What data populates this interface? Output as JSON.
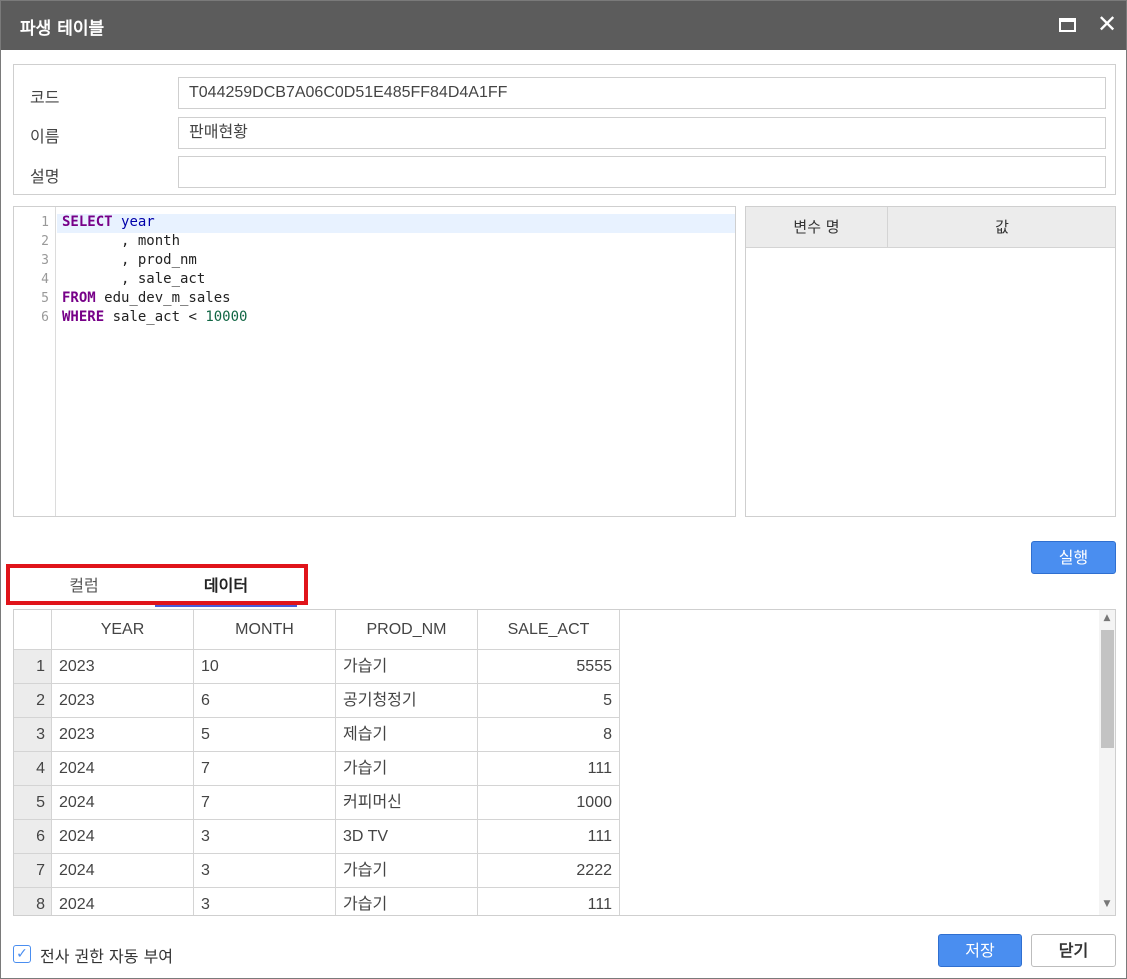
{
  "window": {
    "title": "파생 테이블",
    "maximize_icon": "maximize-icon",
    "close_icon": "close-icon",
    "close_glyph": "✕"
  },
  "form": {
    "code_label": "코드",
    "code_value": "T044259DCB7A06C0D51E485FF84D4A1FF",
    "name_label": "이름",
    "name_value": "판매현황",
    "desc_label": "설명",
    "desc_value": ""
  },
  "editor": {
    "line_numbers": [
      "1",
      "2",
      "3",
      "4",
      "5",
      "6"
    ],
    "lines": [
      {
        "kw": "SELECT",
        "rest": " ",
        "var": "year",
        "num": ""
      },
      {
        "kw": "",
        "rest": "       , month",
        "var": "",
        "num": ""
      },
      {
        "kw": "",
        "rest": "       , prod_nm",
        "var": "",
        "num": ""
      },
      {
        "kw": "",
        "rest": "       , sale_act",
        "var": "",
        "num": ""
      },
      {
        "kw": "FROM",
        "rest": " edu_dev_m_sales",
        "var": "",
        "num": ""
      },
      {
        "kw": "WHERE",
        "rest": " sale_act < ",
        "var": "",
        "num": "10000"
      }
    ]
  },
  "variables": {
    "col_name": "변수 명",
    "col_value": "값"
  },
  "run_button": "실행",
  "tabs": {
    "columns": "컬럼",
    "data": "데이터",
    "active": "data"
  },
  "grid": {
    "headers": [
      "YEAR",
      "MONTH",
      "PROD_NM",
      "SALE_ACT"
    ],
    "rows": [
      [
        "1",
        "2023",
        "10",
        "가습기",
        "5555"
      ],
      [
        "2",
        "2023",
        "6",
        "공기청정기",
        "5"
      ],
      [
        "3",
        "2023",
        "5",
        "제습기",
        "8"
      ],
      [
        "4",
        "2024",
        "7",
        "가습기",
        "111"
      ],
      [
        "5",
        "2024",
        "7",
        "커피머신",
        "1000"
      ],
      [
        "6",
        "2024",
        "3",
        "3D TV",
        "111"
      ],
      [
        "7",
        "2024",
        "3",
        "가습기",
        "2222"
      ],
      [
        "8",
        "2024",
        "3",
        "가습기",
        "111"
      ]
    ],
    "scroll_up": "▲",
    "scroll_down": "▼"
  },
  "footer": {
    "auto_permission_label": "전사 권한 자동 부여",
    "auto_permission_checked": true,
    "check_glyph": "✓",
    "save_button": "저장",
    "close_button": "닫기"
  },
  "colors": {
    "titlebar": "#5c5c5c",
    "primary": "#4a8ef0",
    "active_tab": "#4a5cd8",
    "highlight": "#e0141a"
  }
}
